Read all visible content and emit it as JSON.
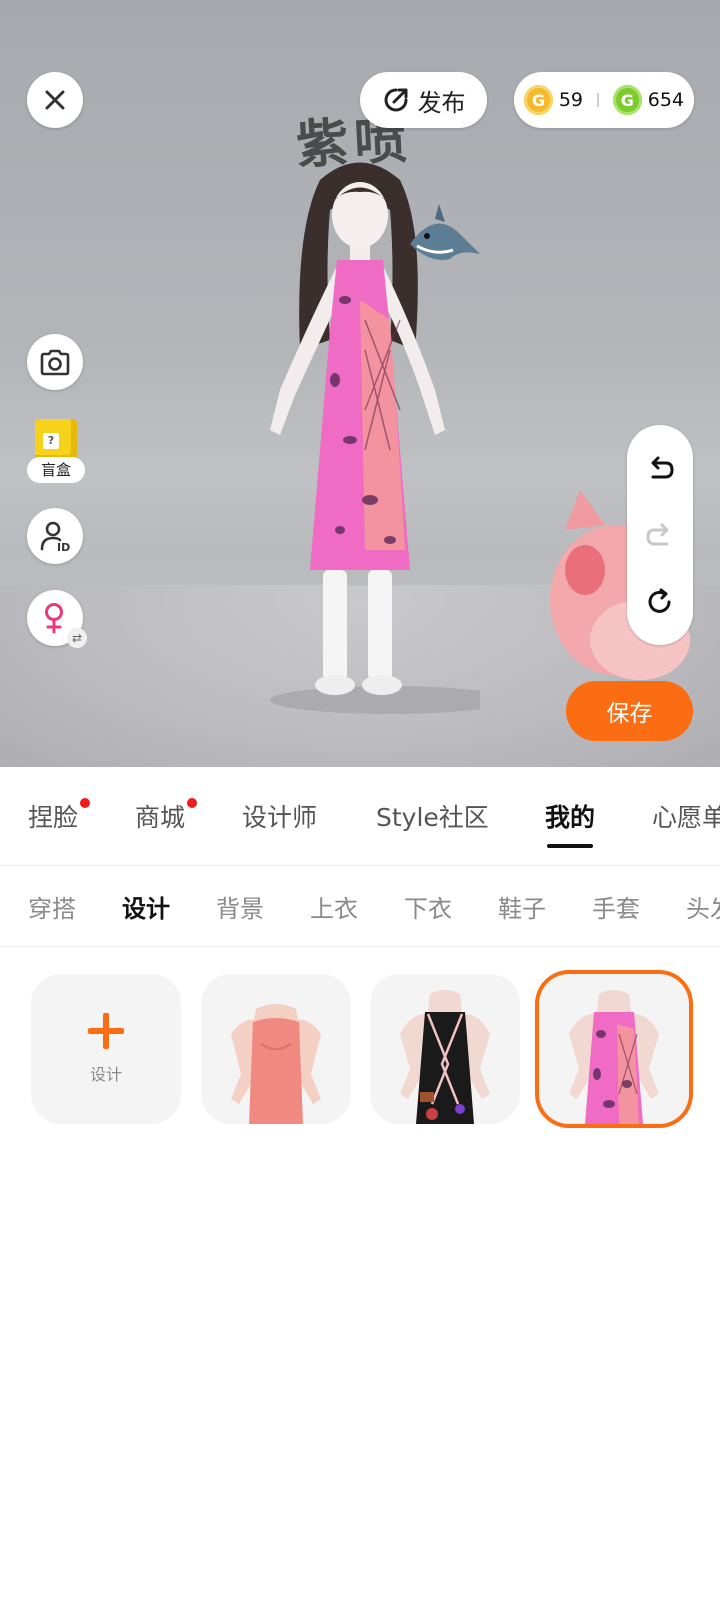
{
  "header": {
    "publish_label": "发布",
    "gold_coin_value": "59",
    "green_coin_value": "654",
    "gold_coin_glyph": "G",
    "green_coin_glyph": "G"
  },
  "scene": {
    "name_art_text": "紫喷"
  },
  "side_buttons": {
    "blindbox_label": "盲盒",
    "blindbox_glyph": "?"
  },
  "save_label": "保存",
  "main_tabs": [
    {
      "label": "捏脸",
      "dot": true
    },
    {
      "label": "商城",
      "dot": true
    },
    {
      "label": "设计师",
      "dot": false
    },
    {
      "label": "Style社区",
      "dot": false
    },
    {
      "label": "我的",
      "active": true
    },
    {
      "label": "心愿单",
      "dot": false
    }
  ],
  "sub_tabs": [
    {
      "label": "穿搭"
    },
    {
      "label": "设计",
      "active": true
    },
    {
      "label": "背景"
    },
    {
      "label": "上衣"
    },
    {
      "label": "下衣"
    },
    {
      "label": "鞋子"
    },
    {
      "label": "手套"
    },
    {
      "label": "头发"
    }
  ],
  "design_grid": {
    "add_label": "设计"
  },
  "colors": {
    "accent": "#fb6d13",
    "dress_pink": "#f06bc3",
    "dress_coral": "#f08a80"
  }
}
